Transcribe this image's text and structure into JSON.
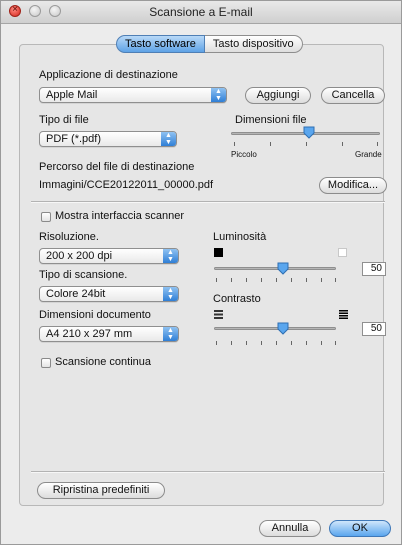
{
  "window": {
    "title": "Scansione a E-mail"
  },
  "tabs": {
    "software": "Tasto software",
    "device": "Tasto dispositivo"
  },
  "dest_app": {
    "label": "Applicazione di destinazione",
    "value": "Apple Mail",
    "add_button": "Aggiungi",
    "delete_button": "Cancella"
  },
  "file_type": {
    "label": "Tipo di file",
    "value": "PDF (*.pdf)"
  },
  "file_size": {
    "label": "Dimensioni file",
    "min_label": "Piccolo",
    "max_label": "Grande"
  },
  "dest_path": {
    "label": "Percorso del file di destinazione",
    "value": "Immagini/CCE20122011_00000.pdf",
    "modify_button": "Modifica..."
  },
  "show_scanner": {
    "label": "Mostra interfaccia scanner",
    "checked": false
  },
  "resolution": {
    "label": "Risoluzione.",
    "value": "200 x 200 dpi"
  },
  "scan_type": {
    "label": "Tipo di scansione.",
    "value": "Colore 24bit"
  },
  "doc_size": {
    "label": "Dimensioni documento",
    "value": "A4 210 x 297 mm"
  },
  "brightness": {
    "label": "Luminosità",
    "value": "50"
  },
  "contrast": {
    "label": "Contrasto",
    "value": "50"
  },
  "continuous": {
    "label": "Scansione continua",
    "checked": false
  },
  "footer": {
    "restore_button": "Ripristina predefiniti",
    "cancel_button": "Annulla",
    "ok_button": "OK"
  },
  "colors": {
    "accent": "#5aa6ee",
    "close_light": "#d4251c"
  }
}
